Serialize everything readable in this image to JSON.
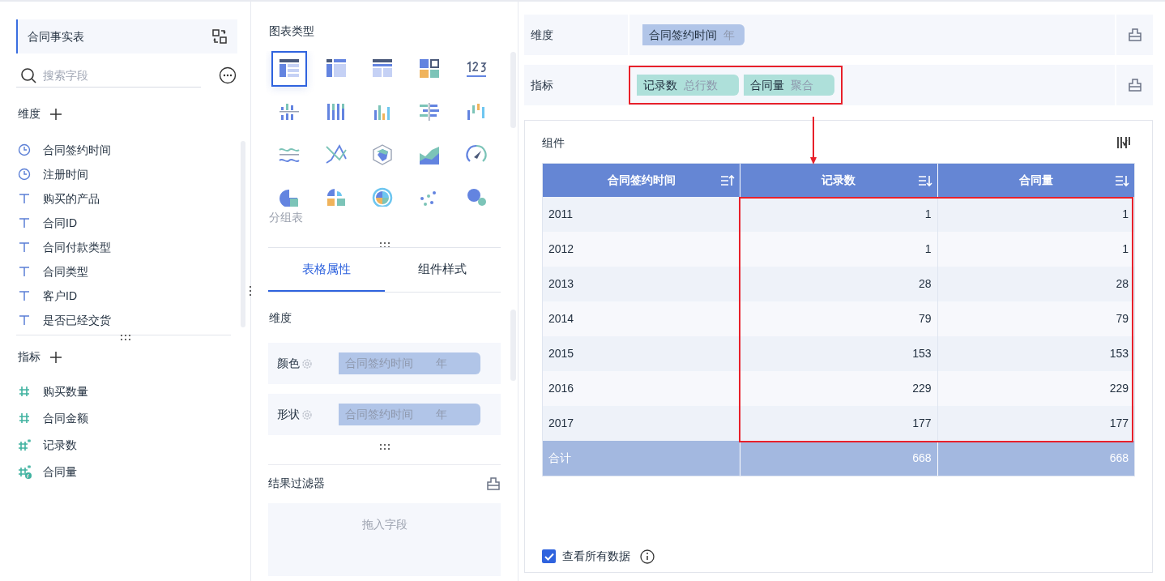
{
  "data_panel": {
    "table_name": "合同事实表",
    "search": {
      "placeholder": "搜索字段"
    },
    "dimensions_title": "维度",
    "dimension_fields": [
      {
        "kind": "time",
        "label": "合同签约时间"
      },
      {
        "kind": "time",
        "label": "注册时间"
      },
      {
        "kind": "text",
        "label": "购买的产品"
      },
      {
        "kind": "text",
        "label": "合同ID"
      },
      {
        "kind": "text",
        "label": "合同付款类型"
      },
      {
        "kind": "text",
        "label": "合同类型"
      },
      {
        "kind": "text",
        "label": "客户ID"
      },
      {
        "kind": "text",
        "label": "是否已经交货"
      }
    ],
    "metrics_title": "指标",
    "metric_fields": [
      {
        "kind": "number",
        "label": "购买数量"
      },
      {
        "kind": "number",
        "label": "合同金额"
      },
      {
        "kind": "calc",
        "label": "记录数"
      },
      {
        "kind": "formula",
        "label": "合同量"
      }
    ]
  },
  "config_panel": {
    "chart_types_title": "图表类型",
    "chart_types": [
      {
        "kind": "table",
        "selected": true
      },
      {
        "kind": "crosstable",
        "selected": false
      },
      {
        "kind": "detailtable",
        "selected": false
      },
      {
        "kind": "kpi",
        "selected": false
      },
      {
        "kind": "number",
        "selected": false
      },
      {
        "kind": "splitbar",
        "selected": false
      },
      {
        "kind": "stackbar",
        "selected": false
      },
      {
        "kind": "bar",
        "selected": false
      },
      {
        "kind": "hbar",
        "selected": false
      },
      {
        "kind": "range",
        "selected": false
      },
      {
        "kind": "wave",
        "selected": false
      },
      {
        "kind": "line",
        "selected": false
      },
      {
        "kind": "radar",
        "selected": false
      },
      {
        "kind": "area",
        "selected": false
      },
      {
        "kind": "gauge",
        "selected": false
      },
      {
        "kind": "pie",
        "selected": false
      },
      {
        "kind": "rose",
        "selected": false
      },
      {
        "kind": "multipie",
        "selected": false
      },
      {
        "kind": "scatter",
        "selected": false
      },
      {
        "kind": "bubble",
        "selected": false
      }
    ],
    "chart_type_name": "分组表",
    "tabs": [
      {
        "label": "表格属性",
        "selected": true
      },
      {
        "label": "组件样式",
        "selected": false
      }
    ],
    "section_title": "维度",
    "properties": [
      {
        "label": "颜色",
        "field": "合同签约时间",
        "unit": "年"
      },
      {
        "label": "形状",
        "field": "合同签约时间",
        "unit": "年"
      }
    ],
    "filter_title": "结果过滤器",
    "filter_placeholder": "拖入字段"
  },
  "editor": {
    "dimension_row": {
      "label": "维度",
      "pills": [
        {
          "kind": "dimension",
          "field": "合同签约时间",
          "detail": "年"
        }
      ]
    },
    "metric_row": {
      "label": "指标",
      "pills": [
        {
          "kind": "metric",
          "field": "记录数",
          "detail": "总行数"
        },
        {
          "kind": "metric",
          "field": "合同量",
          "detail": "聚合"
        }
      ]
    },
    "component_title": "组件",
    "table": {
      "columns": [
        "合同签约时间",
        "记录数",
        "合同量"
      ],
      "rows": [
        [
          "2011",
          "1",
          "1"
        ],
        [
          "2012",
          "1",
          "1"
        ],
        [
          "2013",
          "28",
          "28"
        ],
        [
          "2014",
          "79",
          "79"
        ],
        [
          "2015",
          "153",
          "153"
        ],
        [
          "2016",
          "229",
          "229"
        ],
        [
          "2017",
          "177",
          "177"
        ]
      ],
      "total": [
        "合计",
        "668",
        "668"
      ]
    },
    "view_all": {
      "label": "查看所有数据",
      "checked": true
    }
  }
}
